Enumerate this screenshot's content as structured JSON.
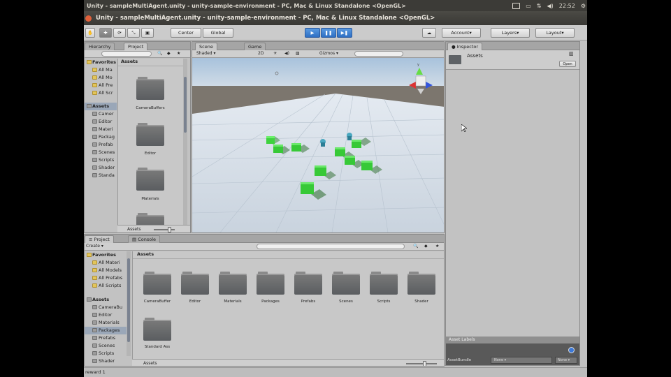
{
  "topbar": {
    "title": "Unity - sampleMultiAgent.unity - unity-sample-environment - PC, Mac & Linux Standalone <OpenGL>",
    "clock": "22:52"
  },
  "window": {
    "title": "Unity - sampleMultiAgent.unity - unity-sample-environment - PC, Mac & Linux Standalone <OpenGL>"
  },
  "toolbar": {
    "pivot_label": "Center",
    "space_label": "Global",
    "account_label": "Account",
    "layers_label": "Layers",
    "layout_label": "Layout"
  },
  "hierarchy": {
    "tab_hierarchy": "Hierarchy",
    "tab_project": "Project",
    "favorites_label": "Favorites",
    "favorites": [
      "All Ma",
      "All Mo",
      "All Pre",
      "All Scr"
    ],
    "assets_label": "Assets",
    "assets": [
      "Camer",
      "Editor",
      "Materi",
      "Packag",
      "Prefab",
      "Scenes",
      "Scripts",
      "Shader",
      "Standa"
    ],
    "grid_header": "Assets",
    "grid_items": [
      "CameraBuffers",
      "Editor",
      "Materials",
      ""
    ],
    "footer": "Assets"
  },
  "scene": {
    "tab_scene": "Scene",
    "tab_game": "Game",
    "shaded_label": "Shaded",
    "mode_2d": "2D",
    "gizmos_label": "Gizmos"
  },
  "inspector": {
    "tab": "Inspector",
    "title": "Assets",
    "open_label": "Open",
    "asset_labels": "Asset Labels",
    "assetbundle_label": "AssetBundle",
    "none_label": "None",
    "none_label2": "None"
  },
  "project": {
    "tab_project": "Project",
    "tab_console": "Console",
    "create_label": "Create",
    "favorites_label": "Favorites",
    "favorites": [
      "All Materi",
      "All Models",
      "All Prefabs",
      "All Scripts"
    ],
    "assets_label": "Assets",
    "assets": [
      "CameraBu",
      "Editor",
      "Materials",
      "Packages",
      "Prefabs",
      "Scenes",
      "Scripts",
      "Shader"
    ],
    "grid_header": "Assets",
    "grid_items": [
      "CameraBuffer",
      "Editor",
      "Materials",
      "Packages",
      "Prefabs",
      "Scenes",
      "Scripts",
      "Shader",
      "Standard Ass"
    ],
    "footer": "Assets"
  },
  "status": {
    "text": "reward 1"
  }
}
